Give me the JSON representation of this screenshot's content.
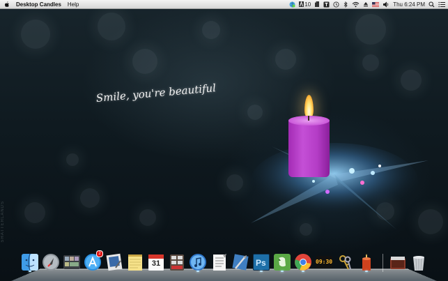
{
  "menubar": {
    "app_name": "Desktop Candles",
    "menus": [
      "Help"
    ],
    "status": {
      "badge_count": "10",
      "clock": "Thu 6:24 PM"
    }
  },
  "wallpaper": {
    "tagline": "Smile, you're beautiful",
    "watermark": "SHATTERLANDS"
  },
  "dock": {
    "app_store_badge": "2",
    "calendar_day": "31",
    "dashboard_time": "09:30",
    "apps": [
      {
        "name": "finder-icon"
      },
      {
        "name": "launchpad-icon"
      },
      {
        "name": "photo-booth-icon"
      },
      {
        "name": "app-store-icon"
      },
      {
        "name": "preview-icon"
      },
      {
        "name": "notes-icon"
      },
      {
        "name": "calendar-icon"
      },
      {
        "name": "photo-slideshow-icon"
      },
      {
        "name": "itunes-icon"
      },
      {
        "name": "text-edit-icon"
      },
      {
        "name": "xcode-icon"
      },
      {
        "name": "photoshop-icon"
      },
      {
        "name": "evernote-icon"
      },
      {
        "name": "chrome-icon"
      },
      {
        "name": "dashboard-icon"
      },
      {
        "name": "keychain-icon"
      },
      {
        "name": "candle-app-icon"
      },
      {
        "name": "downloads-stack-icon"
      },
      {
        "name": "trash-icon"
      }
    ]
  },
  "colors": {
    "candle": "#b43cc6",
    "photoshop": "#1d6fa8",
    "evernote": "#5aa845"
  }
}
